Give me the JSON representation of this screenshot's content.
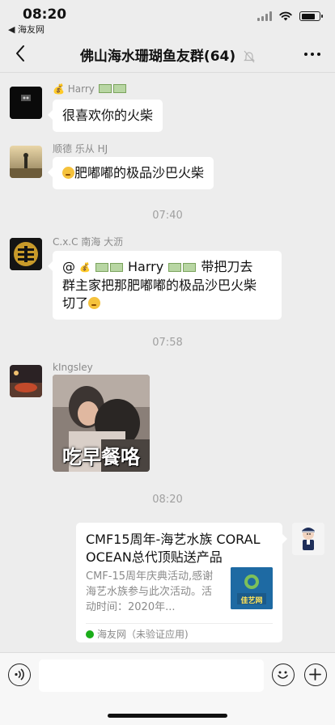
{
  "status_bar": {
    "time": "08:20",
    "back_app": "◀ 海友网"
  },
  "nav": {
    "title": "佛山海水珊瑚鱼友群(64)"
  },
  "messages": [
    {
      "sender": "💰 Harry",
      "text": "很喜欢你的火柴"
    },
    {
      "sender": "顺德 乐从 HJ",
      "text": "肥嘟嘟的极品沙巴火柴"
    },
    {
      "sender": "C.x.C 南海 大沥",
      "text_line1": "@",
      "mention": "Harry",
      "text_after_mention": " 带把刀去",
      "text_line2": "群主家把那肥嘟嘟的极品沙巴火柴",
      "text_line3": "切了"
    },
    {
      "sender": "kIngsley",
      "image_caption": "吃早餐咯"
    }
  ],
  "timestamps": [
    "07:40",
    "07:58",
    "08:20"
  ],
  "share_card": {
    "title": "CMF15周年-海艺水族 CORAL OCEAN总代顶贴送产品",
    "description": "CMF-15周年庆典活动,感谢海艺水族参与此次活动。活动时间：2020年...",
    "source": "海友网（未验证应用)",
    "thumb_text": "佳艺网"
  },
  "input": {
    "placeholder": ""
  },
  "colors": {
    "background": "#ededed",
    "bubble": "#ffffff",
    "timestamp": "#a0a0a0",
    "sender": "#8a8a8a"
  }
}
